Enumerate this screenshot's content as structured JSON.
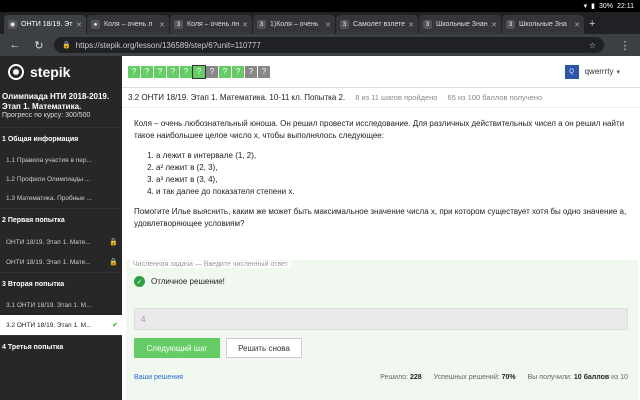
{
  "status": {
    "battery": "30%",
    "time": "22:11"
  },
  "browser": {
    "tabs": [
      {
        "label": "ОНТИ 18/19. Эт",
        "favicon": "stepik-icon",
        "active": true
      },
      {
        "label": "Коля – очень л",
        "favicon": "chrome-icon",
        "active": false
      },
      {
        "label": "Коля – очень лн",
        "favicon": "3",
        "active": false
      },
      {
        "label": "1)Коля – очень",
        "favicon": "3",
        "active": false
      },
      {
        "label": "Самолет взлете",
        "favicon": "3",
        "active": false
      },
      {
        "label": "Школьные Знан",
        "favicon": "3",
        "active": false
      },
      {
        "label": "Школьные Зна",
        "favicon": "3",
        "active": false
      }
    ],
    "url": "https://stepik.org/lesson/136589/step/6?unit=110777"
  },
  "header": {
    "logo": "stepik",
    "steps": [
      "ok",
      "ok",
      "ok",
      "ok",
      "ok",
      "cur",
      "no",
      "ok",
      "ok",
      "no",
      "no"
    ],
    "user": {
      "avatar": "Q",
      "name": "qwerrrty"
    }
  },
  "sidebar": {
    "course_title": "Олимпиада НТИ 2018-2019. Этап 1. Математика.",
    "progress": "Прогресс по курсу:  300/500",
    "sections": [
      {
        "title": "1  Общая информация",
        "items": [
          {
            "label": "1.1  Правила участия в пер...",
            "locked": false,
            "active": false
          },
          {
            "label": "1.2  Профили Олимпиады ...",
            "locked": false,
            "active": false
          },
          {
            "label": "1.3  Математика. Пробные ...",
            "locked": false,
            "active": false
          }
        ]
      },
      {
        "title": "2  Первая попытка",
        "items": [
          {
            "label": "ОНТИ 18/19. Этап 1. Мате...",
            "locked": true,
            "active": false
          },
          {
            "label": "ОНТИ 18/19. Этап 1. Мате...",
            "locked": true,
            "active": false
          }
        ]
      },
      {
        "title": "3  Вторая попытка",
        "items": [
          {
            "label": "3.1  ОНТИ 18/19. Этап 1. М...",
            "locked": false,
            "active": false
          },
          {
            "label": "3.2  ОНТИ 18/19. Этап 1. М...",
            "locked": false,
            "active": true
          }
        ]
      },
      {
        "title": "4  Третья попытка",
        "items": []
      }
    ]
  },
  "lesson": {
    "title": "3.2 ОНТИ 18/19. Этап 1. Математика. 10-11 кл. Попытка 2.",
    "steps_done": "8 из 11 шагов пройдено",
    "points": "65 из 100 баллов  получено"
  },
  "problem": {
    "intro": "Коля – очень любознательный юноша. Он решил провести исследование. Для различных действительных чисел a он решил найти такое наибольшее целое число x, чтобы выполнялось следующее:",
    "conditions": [
      "a лежит в интервале (1, 2),",
      "a² лежит в (2, 3),",
      "a³ лежит в (3, 4),",
      "и так далее до показателя степени x."
    ],
    "question": "Помогите Илье выяснить, каким же может быть максимальное значение числа x, при котором существует хотя бы одно значение a, удовлетворяющее условиям?"
  },
  "answer": {
    "type_label": "Численная задача — Введите численный ответ",
    "result": "Отличное решение!",
    "value": "4",
    "next_button": "Следующий шаг",
    "retry_button": "Решить снова",
    "solutions_link": "Ваши решения",
    "solved_label": "Решило:",
    "solved": "228",
    "success_label": "Успешных решений:",
    "success": "70%",
    "earned_label": "Вы получили:",
    "earned": "10 баллов",
    "earned_of": "из 10"
  }
}
